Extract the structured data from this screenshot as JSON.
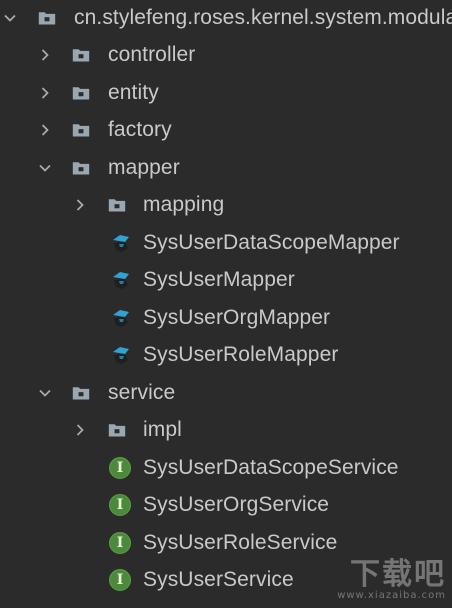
{
  "tree": {
    "rows": [
      {
        "label": "cn.stylefeng.roses.kernel.system.modular.user",
        "expanded": true,
        "icon": "package-folder-icon"
      },
      {
        "label": "controller",
        "expanded": false,
        "icon": "package-folder-icon"
      },
      {
        "label": "entity",
        "expanded": false,
        "icon": "package-folder-icon"
      },
      {
        "label": "factory",
        "expanded": false,
        "icon": "package-folder-icon"
      },
      {
        "label": "mapper",
        "expanded": true,
        "icon": "package-folder-icon"
      },
      {
        "label": "mapping",
        "expanded": false,
        "icon": "package-folder-icon"
      },
      {
        "label": "SysUserDataScopeMapper",
        "icon": "mybatis-mapper-icon"
      },
      {
        "label": "SysUserMapper",
        "icon": "mybatis-mapper-icon"
      },
      {
        "label": "SysUserOrgMapper",
        "icon": "mybatis-mapper-icon"
      },
      {
        "label": "SysUserRoleMapper",
        "icon": "mybatis-mapper-icon"
      },
      {
        "label": "service",
        "expanded": true,
        "icon": "package-folder-icon"
      },
      {
        "label": "impl",
        "expanded": false,
        "icon": "package-folder-icon"
      },
      {
        "label": "SysUserDataScopeService",
        "icon": "interface-icon",
        "icon_letter": "I"
      },
      {
        "label": "SysUserOrgService",
        "icon": "interface-icon",
        "icon_letter": "I"
      },
      {
        "label": "SysUserRoleService",
        "icon": "interface-icon",
        "icon_letter": "I"
      },
      {
        "label": "SysUserService",
        "icon": "interface-icon",
        "icon_letter": "I"
      }
    ]
  },
  "watermark": {
    "main": "下载吧",
    "sub": "www.xiazaiba.com"
  },
  "colors": {
    "background": "#2b2b2b",
    "text": "#c9c9c9",
    "folder": "#9aa7b0",
    "interface": "#4b8a3a",
    "mapper_blue": "#2fa4d4"
  }
}
